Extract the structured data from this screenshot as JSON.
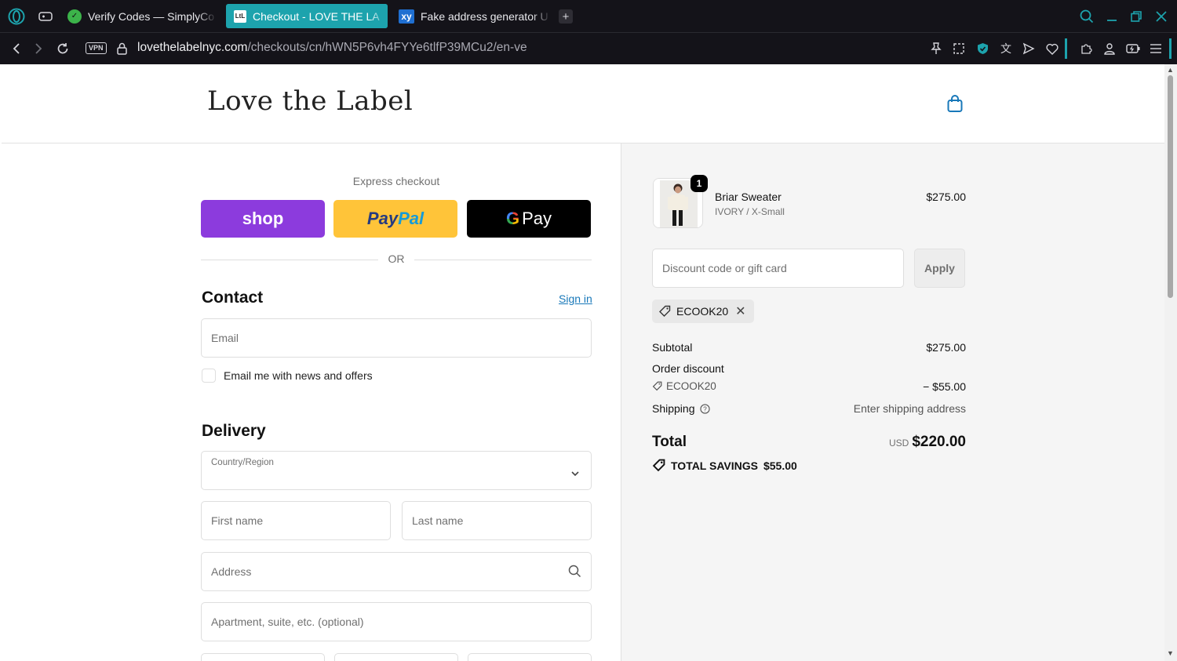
{
  "browser": {
    "tabs": [
      {
        "title": "Verify Codes — SimplyCo",
        "favicon": "check-circle-icon",
        "active": false
      },
      {
        "title": "Checkout - LOVE THE LA",
        "favicon": "page-icon",
        "active": true
      },
      {
        "title": "Fake address generator U",
        "favicon": "xy-icon",
        "active": false
      }
    ],
    "url_host": "lovethelabelnyc.com",
    "url_path": "/checkouts/cn/hWN5P6vh4FYYe6tlfP39MCu2/en-ve",
    "vpn_label": "VPN",
    "accent_color": "#1da3ad"
  },
  "store": {
    "logo_text": "Love the Label"
  },
  "checkout": {
    "express_label": "Express checkout",
    "shop_label": "shop",
    "paypal_label_1": "Pay",
    "paypal_label_2": "Pal",
    "gpay_label": "Pay",
    "or_label": "OR",
    "contact_title": "Contact",
    "sign_in_label": "Sign in",
    "email_placeholder": "Email",
    "newsletter_label": "Email me with news and offers",
    "delivery_title": "Delivery",
    "country_label": "Country/Region",
    "first_name_placeholder": "First name",
    "last_name_placeholder": "Last name",
    "address_placeholder": "Address",
    "apartment_placeholder": "Apartment, suite, etc. (optional)"
  },
  "summary": {
    "product": {
      "name": "Briar Sweater",
      "variant": "IVORY / X-Small",
      "price": "$275.00",
      "quantity": "1"
    },
    "discount_placeholder": "Discount code or gift card",
    "apply_label": "Apply",
    "applied_code": "ECOOK20",
    "subtotal_label": "Subtotal",
    "subtotal_value": "$275.00",
    "order_discount_label": "Order discount",
    "discount_code": "ECOOK20",
    "discount_value": "− $55.00",
    "shipping_label": "Shipping",
    "shipping_value": "Enter shipping address",
    "total_label": "Total",
    "total_currency": "USD",
    "total_value": "$220.00",
    "savings_label": "TOTAL SAVINGS",
    "savings_value": "$55.00"
  }
}
